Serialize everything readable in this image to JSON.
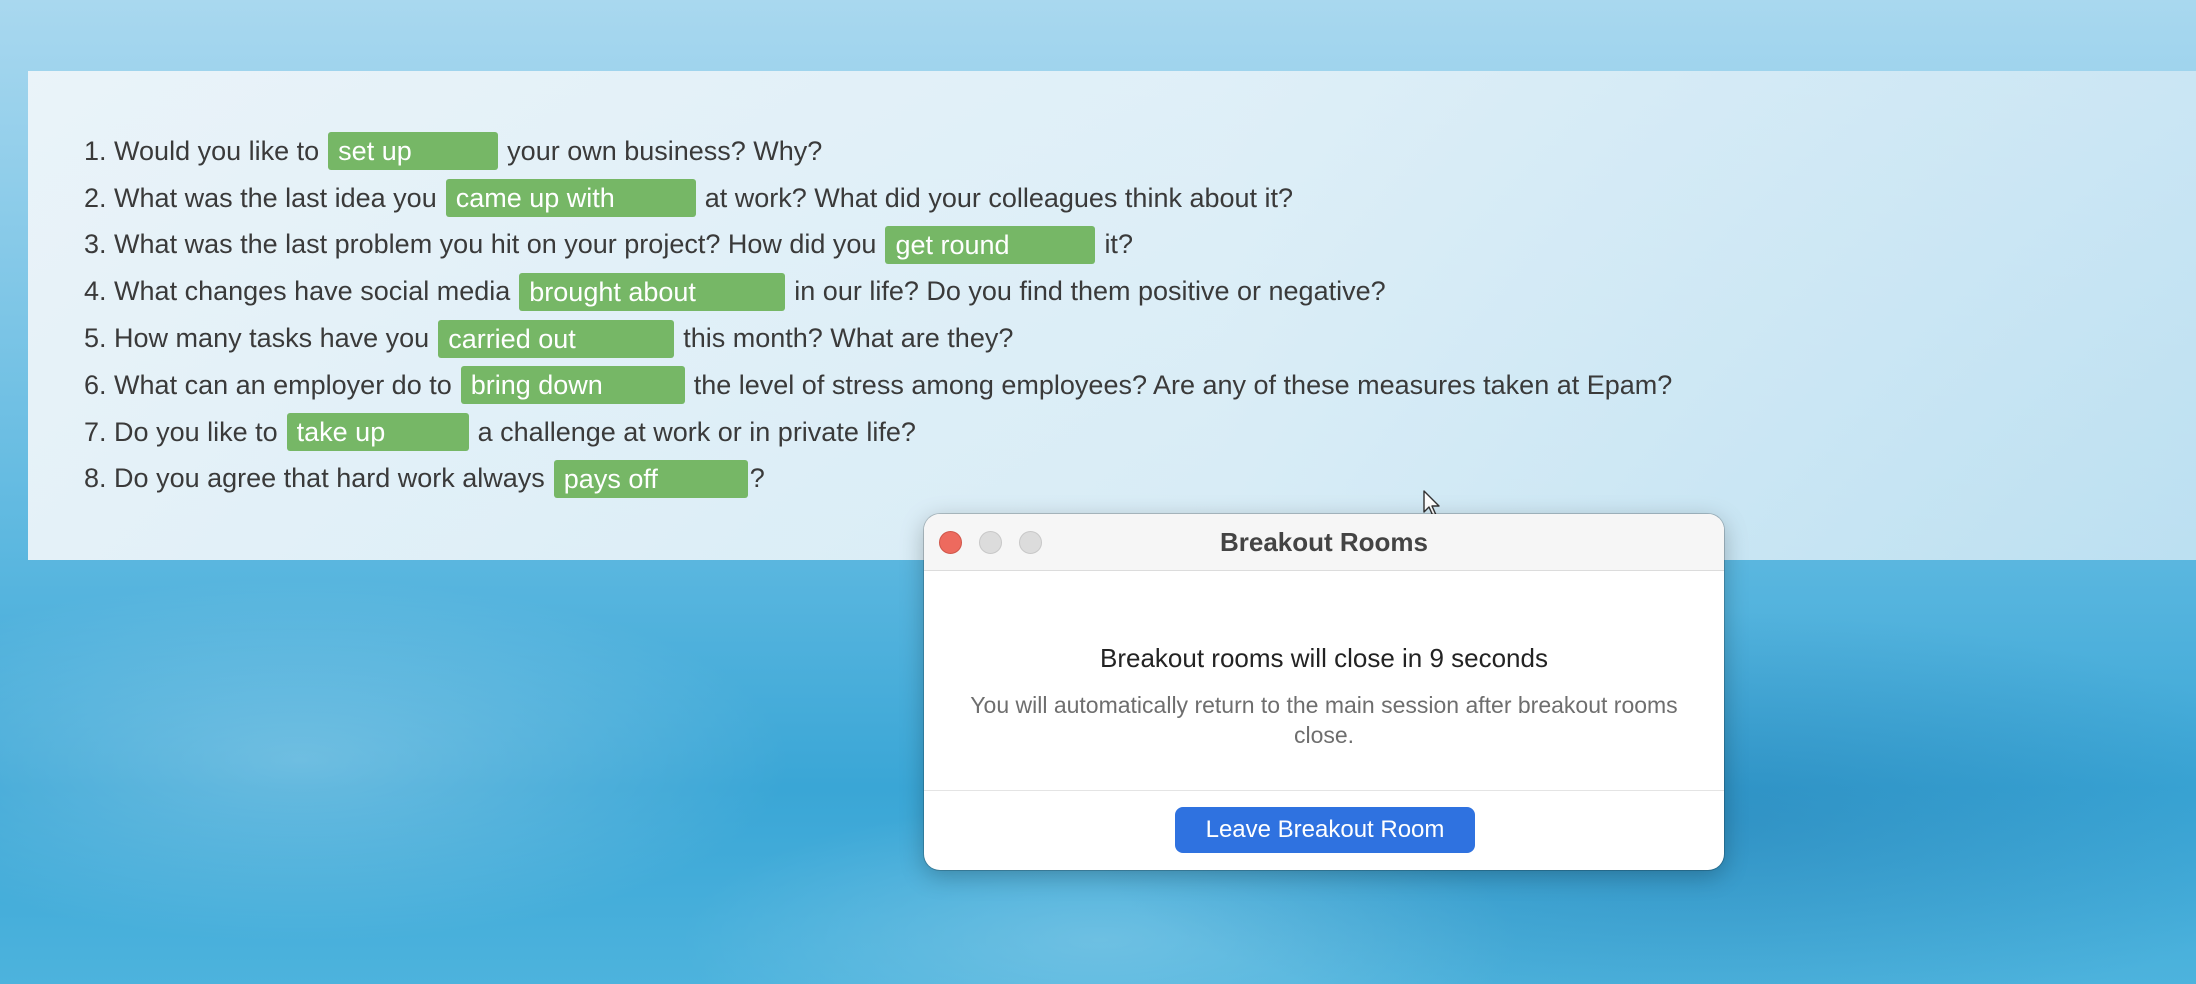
{
  "questions": [
    {
      "num": "1.",
      "before": "Would you like to",
      "answer": "set up",
      "after": "your own business? Why?"
    },
    {
      "num": "2.",
      "before": "What was the last idea you",
      "answer": "came up with",
      "after": "at work? What did your colleagues think about it?"
    },
    {
      "num": "3.",
      "before": "What was the last problem you hit on your project? How did you",
      "answer": "get round",
      "after": "it?"
    },
    {
      "num": "4.",
      "before": "What changes have social media",
      "answer": "brought about",
      "after": "in our life? Do you find them positive or negative?"
    },
    {
      "num": "5.",
      "before": "How many tasks have you",
      "answer": "carried out",
      "after": "this month? What are they?"
    },
    {
      "num": "6.",
      "before": "What can an employer do to",
      "answer": "bring down",
      "after": "the level of stress among employees? Are any of these measures taken at Epam?"
    },
    {
      "num": "7.",
      "before": "Do you like to",
      "answer": "take up",
      "after": "a challenge at work or in private life?"
    },
    {
      "num": "8.",
      "before": "Do you agree that hard work always",
      "answer": "pays off",
      "after": "?"
    }
  ],
  "dialog": {
    "title": "Breakout Rooms",
    "heading": "Breakout rooms will close in 9 seconds",
    "message": "You will automatically return to the main session after breakout rooms close.",
    "button_label": "Leave Breakout Room"
  },
  "colors": {
    "answer_fill": "#76b766",
    "button_blue": "#2f72e0",
    "close_red": "#ed6a5e"
  }
}
